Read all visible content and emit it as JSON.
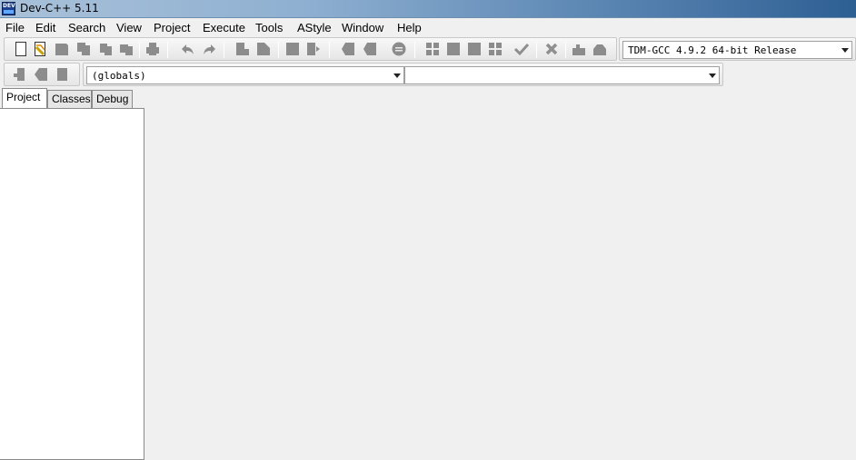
{
  "window": {
    "title": "Dev-C++ 5.11",
    "icon_text": "DEV"
  },
  "menu": {
    "items": [
      "File",
      "Edit",
      "Search",
      "View",
      "Project",
      "Execute",
      "Tools",
      "AStyle",
      "Window",
      "Help"
    ]
  },
  "toolbar": {
    "compiler_select": "TDM-GCC 4.9.2 64-bit Release",
    "scope_select": "(globals)",
    "member_select": ""
  },
  "left_panel": {
    "tabs": [
      "Project",
      "Classes",
      "Debug"
    ],
    "active_tab": "Project"
  },
  "colors": {
    "titlebar_start": "#a9c1d9",
    "titlebar_end": "#2e5f93",
    "icon_gray": "#8c8c8c",
    "check_gray": "#8f8f8f",
    "background": "#f0f0f0"
  }
}
